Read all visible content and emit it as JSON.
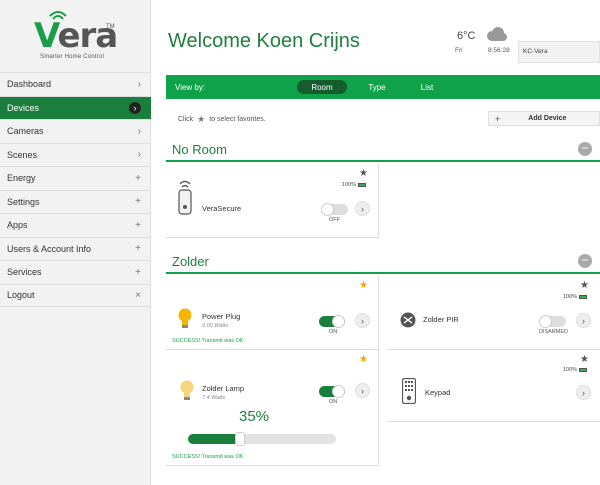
{
  "logo": {
    "word": "era",
    "first": "V",
    "tagline": "Smarter Home Control",
    "tm": "TM"
  },
  "nav": [
    {
      "label": "Dashboard",
      "indicator": "›"
    },
    {
      "label": "Devices",
      "indicator": "›",
      "active": true
    },
    {
      "label": "Cameras",
      "indicator": "›"
    },
    {
      "label": "Scenes",
      "indicator": "›"
    },
    {
      "label": "Energy",
      "indicator": "+"
    },
    {
      "label": "Settings",
      "indicator": "+"
    },
    {
      "label": "Apps",
      "indicator": "+"
    },
    {
      "label": "Users & Account Info",
      "indicator": "+"
    },
    {
      "label": "Services",
      "indicator": "+"
    },
    {
      "label": "Logout",
      "indicator": "×"
    }
  ],
  "header": {
    "welcome": "Welcome Koen Crijns",
    "temp": "6°C",
    "day": "Fri",
    "time": "8:56:28",
    "location": "KC-Vera"
  },
  "viewbar": {
    "label": "View by:",
    "tabs": [
      "Room",
      "Type",
      "List"
    ],
    "active": "Room"
  },
  "hint": {
    "pre": "Click",
    "post": "to select favorites."
  },
  "add_device": {
    "plus": "+",
    "label": "Add Device"
  },
  "sections": {
    "no_room": "No Room",
    "zolder": "Zolder"
  },
  "devices": {
    "verasecure": {
      "name": "VeraSecure",
      "battery": "100%",
      "state": "OFF",
      "favorite": false
    },
    "power_plug": {
      "name": "Power Plug",
      "sub": "0.00 Watts",
      "state": "ON",
      "status": "SUCCESS! Transmit was OK",
      "favorite": true
    },
    "zolder_pir": {
      "name": "Zolder PIR",
      "battery": "100%",
      "state": "DISARMED",
      "favorite": false
    },
    "zolder_lamp": {
      "name": "Zolder Lamp",
      "sub": "7.4 Watts",
      "state": "ON",
      "dim": "35%",
      "level": 0.35,
      "status": "SUCCESS! Transmit was OK",
      "favorite": true
    },
    "keypad": {
      "name": "Keypad",
      "battery": "100%",
      "favorite": false
    }
  },
  "colors": {
    "brand": "#1a7f3c",
    "bar": "#0fa24a",
    "star_on": "#f0a500"
  }
}
